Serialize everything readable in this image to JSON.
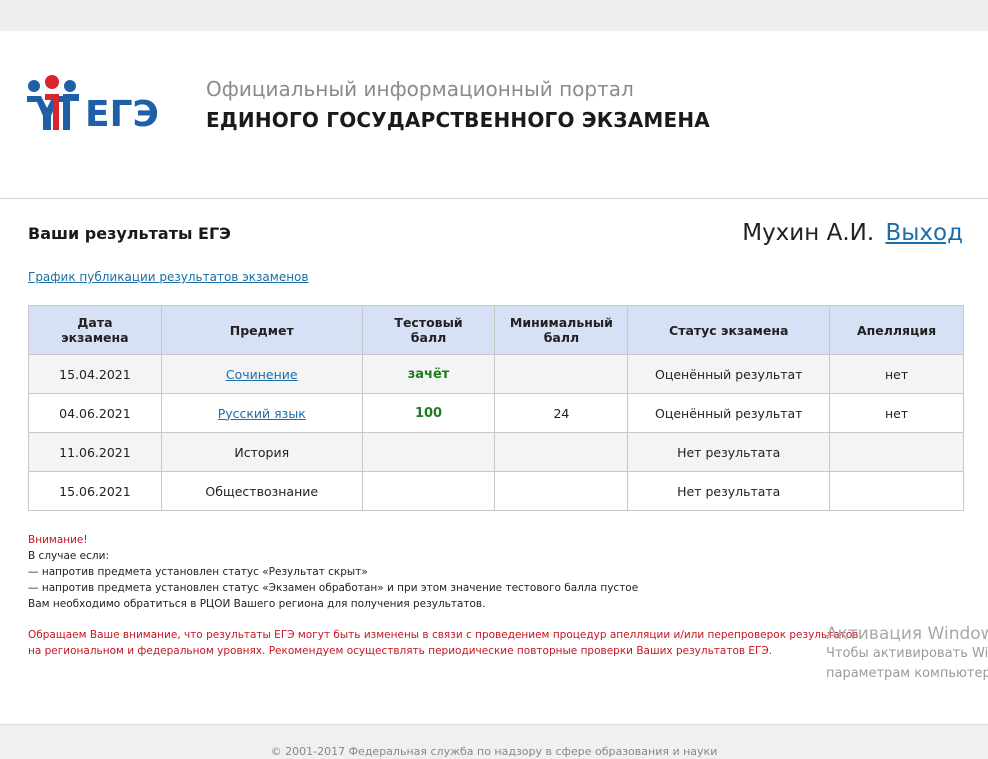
{
  "header": {
    "logo_text": "ЕГЭ",
    "portal_line1": "Официальный информационный портал",
    "portal_line2": "ЕДИНОГО ГОСУДАРСТВЕННОГО ЭКЗАМЕНА",
    "colors": {
      "logo_blue": "#1f5fa8",
      "logo_red": "#d9232d"
    }
  },
  "page": {
    "title": "Ваши результаты ЕГЭ",
    "user_name": "Мухин А.И.",
    "logout_label": "Выход",
    "schedule_link": "График публикации результатов экзаменов"
  },
  "table": {
    "headers": {
      "date": [
        "Дата",
        "экзамена"
      ],
      "subject": "Предмет",
      "test_score": [
        "Тестовый",
        "балл"
      ],
      "min_score": [
        "Минимальный",
        "балл"
      ],
      "status": "Статус экзамена",
      "appeal": "Апелляция"
    },
    "rows": [
      {
        "date": "15.04.2021",
        "subject": "Сочинение",
        "subject_link": true,
        "test_score": "зачёт",
        "min_score": "",
        "status": "Оценённый результат",
        "appeal": "нет"
      },
      {
        "date": "04.06.2021",
        "subject": "Русский язык",
        "subject_link": true,
        "test_score": "100",
        "min_score": "24",
        "status": "Оценённый результат",
        "appeal": "нет"
      },
      {
        "date": "11.06.2021",
        "subject": "История",
        "subject_link": false,
        "test_score": "",
        "min_score": "",
        "status": "Нет результата",
        "appeal": ""
      },
      {
        "date": "15.06.2021",
        "subject": "Обществознание",
        "subject_link": false,
        "test_score": "",
        "min_score": "",
        "status": "Нет результата",
        "appeal": ""
      }
    ]
  },
  "notice": {
    "warning": "Внимание!",
    "lines": [
      "В случае если:",
      "— напротив предмета установлен статус «Результат скрыт»",
      "— напротив предмета установлен статус «Экзамен обработан» и при этом значение тестового балла пустое",
      "Вам необходимо обратиться в РЦОИ Вашего региона для получения результатов."
    ],
    "attention_line1": "Обращаем Ваше внимание, что результаты ЕГЭ могут быть изменены в связи с проведением процедур апелляции и/или перепроверок результатов",
    "attention_line2": "на региональном и федеральном уровнях. Рекомендуем осуществлять периодические повторные проверки Ваших результатов ЕГЭ."
  },
  "windows_overlay": {
    "title": "Активация Windows",
    "line1": "Чтобы активировать Windows,",
    "line2": "параметрам компьютера."
  },
  "footer": {
    "text": "© 2001-2017 Федеральная служба по надзору в сфере образования и науки"
  }
}
